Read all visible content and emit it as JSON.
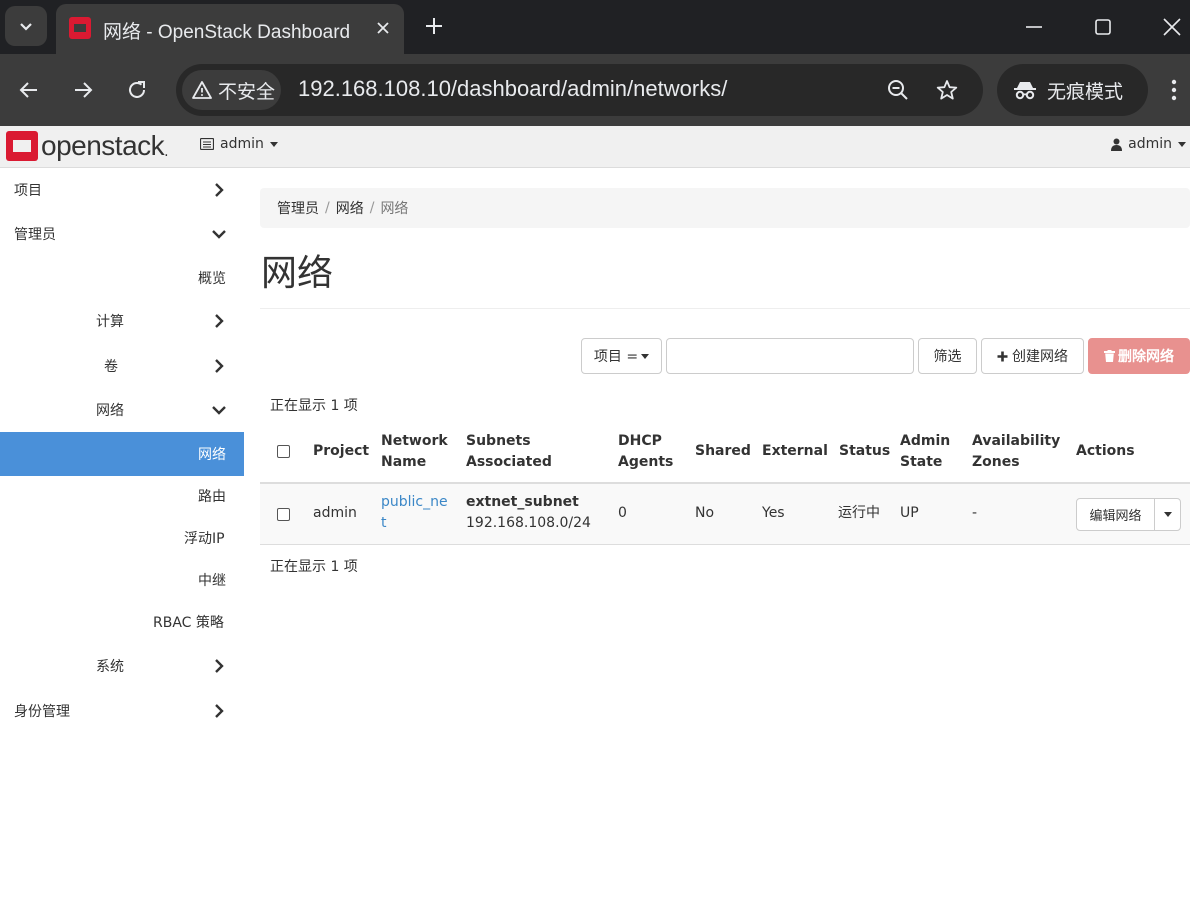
{
  "browser": {
    "tab_title": "网络 - OpenStack Dashboard",
    "security_label": "不安全",
    "url": "192.168.108.10/dashboard/admin/networks/",
    "incognito_label": "无痕模式"
  },
  "header": {
    "logo_text": "openstack",
    "logo_mark": ".",
    "project": "admin",
    "user": "admin",
    "brand_color": "#da1a32"
  },
  "sidebar": {
    "project": "项目",
    "admin": "管理员",
    "overview": "概览",
    "compute": "计算",
    "volume": "卷",
    "network_group": "网络",
    "networks": "网络",
    "routers": "路由",
    "floating_ips": "浮动IP",
    "trunks": "中继",
    "rbac": "RBAC 策略",
    "system": "系统",
    "identity": "身份管理"
  },
  "breadcrumb": [
    "管理员",
    "网络",
    "网络"
  ],
  "page_title": "网络",
  "filter": {
    "select_label": "项目 =",
    "input_value": "",
    "filter_button": "筛选",
    "create_button": "创建网络",
    "delete_button": "删除网络"
  },
  "count_label": "正在显示 1 项",
  "table": {
    "headers": {
      "project": "Project",
      "network_name_1": "Network",
      "network_name_2": "Name",
      "subnets_1": "Subnets",
      "subnets_2": "Associated",
      "dhcp_1": "DHCP",
      "dhcp_2": "Agents",
      "shared": "Shared",
      "external": "External",
      "status": "Status",
      "admin_state_1": "Admin",
      "admin_state_2": "State",
      "az_1": "Availability",
      "az_2": "Zones",
      "actions": "Actions"
    },
    "rows": [
      {
        "project": "admin",
        "name_1": "public_ne",
        "name_2": "t",
        "subnet_name": "extnet_subnet",
        "subnet_cidr": "192.168.108.0/24",
        "dhcp_agents": "0",
        "shared": "No",
        "external": "Yes",
        "status": "运行中",
        "admin_state": "UP",
        "availability_zones": "-",
        "action": "编辑网络"
      }
    ]
  }
}
